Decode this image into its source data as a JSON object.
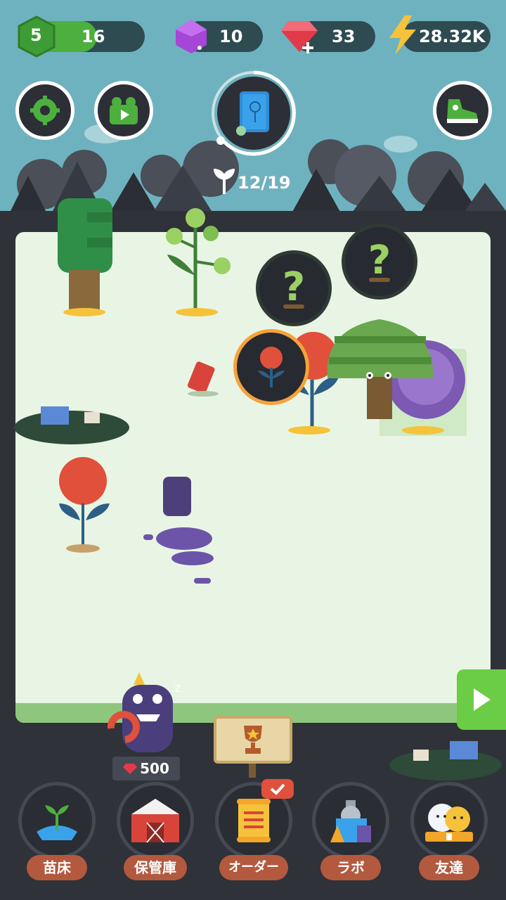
{
  "status": {
    "level": "5",
    "level_progress": "16",
    "gems": "10",
    "rubies": "33",
    "energy": "28.32K"
  },
  "collection": {
    "progress": "12/19"
  },
  "reward": {
    "cost": "500"
  },
  "nav": {
    "nursery": "苗床",
    "storage": "保管庫",
    "orders": "オーダー",
    "lab": "ラボ",
    "friends": "友達"
  },
  "colors": {
    "level_green": "#4caf3e",
    "gem_purple": "#a646d6",
    "ruby_red": "#e33a4a",
    "energy_yellow": "#f6c23a",
    "nav_label": "#b3593e",
    "play_green": "#6bcc45"
  },
  "icons": {
    "settings": "gear-icon",
    "video": "video-camera-icon",
    "encyclopedia": "book-icon",
    "shoe": "sneaker-icon",
    "play": "play-icon"
  }
}
